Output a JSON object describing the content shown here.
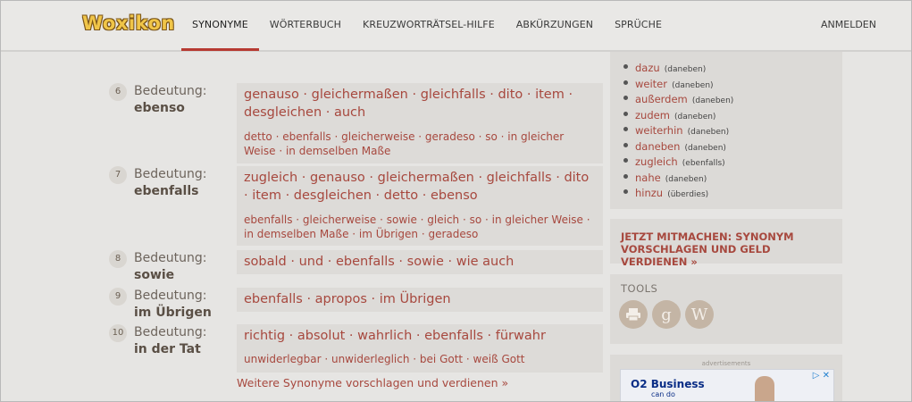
{
  "header": {
    "logo": "Woxikon",
    "nav": [
      "SYNONYME",
      "WÖRTERBUCH",
      "KREUZWORTRÄTSEL-HILFE",
      "ABKÜRZUNGEN",
      "SPRÜCHE"
    ],
    "active": "SYNONYME",
    "login": "ANMELDEN"
  },
  "meanings": [
    {
      "num": "6",
      "label": "Bedeutung:",
      "word": "ebenso",
      "primary": "genauso · gleichermaßen · gleichfalls · dito · item · desgleichen · auch",
      "secondary": "detto · ebenfalls · gleicherweise · geradeso · so · in gleicher Weise · in demselben Maße"
    },
    {
      "num": "7",
      "label": "Bedeutung:",
      "word": "ebenfalls",
      "primary": "zugleich · genauso · gleichermaßen · gleichfalls · dito · item · desgleichen · detto · ebenso",
      "secondary": "ebenfalls · gleicherweise · sowie · gleich · so · in gleicher Weise · in demselben Maße · im Übrigen · geradeso"
    },
    {
      "num": "8",
      "label": "Bedeutung:",
      "word": "sowie",
      "primary": "sobald · und · ebenfalls · sowie · wie auch",
      "secondary": ""
    },
    {
      "num": "9",
      "label": "Bedeutung:",
      "word": "im Übrigen",
      "primary": "ebenfalls · apropos · im Übrigen",
      "secondary": ""
    },
    {
      "num": "10",
      "label": "Bedeutung:",
      "word": "in der Tat",
      "primary": "richtig · absolut · wahrlich · ebenfalls · fürwahr",
      "secondary": "unwiderlegbar · unwiderleglich · bei Gott · weiß Gott"
    }
  ],
  "more_link": "Weitere Synonyme vorschlagen und verdienen »",
  "sidebar": {
    "related": [
      {
        "word": "dazu",
        "tag": "(daneben)"
      },
      {
        "word": "weiter",
        "tag": "(daneben)"
      },
      {
        "word": "außerdem",
        "tag": "(daneben)"
      },
      {
        "word": "zudem",
        "tag": "(daneben)"
      },
      {
        "word": "weiterhin",
        "tag": "(daneben)"
      },
      {
        "word": "daneben",
        "tag": "(daneben)"
      },
      {
        "word": "zugleich",
        "tag": "(ebenfalls)"
      },
      {
        "word": "nahe",
        "tag": "(daneben)"
      },
      {
        "word": "hinzu",
        "tag": "(überdies)"
      }
    ],
    "cta": "JETZT MITMACHEN: SYNONYM VORSCHLAGEN UND GELD VERDIENEN »",
    "tools_title": "TOOLS",
    "tools": [
      "printer-icon",
      "google-icon",
      "wikipedia-icon"
    ],
    "ad_label": "advertisements",
    "ad_brand": "O2 Business",
    "ad_sub": "can do"
  }
}
